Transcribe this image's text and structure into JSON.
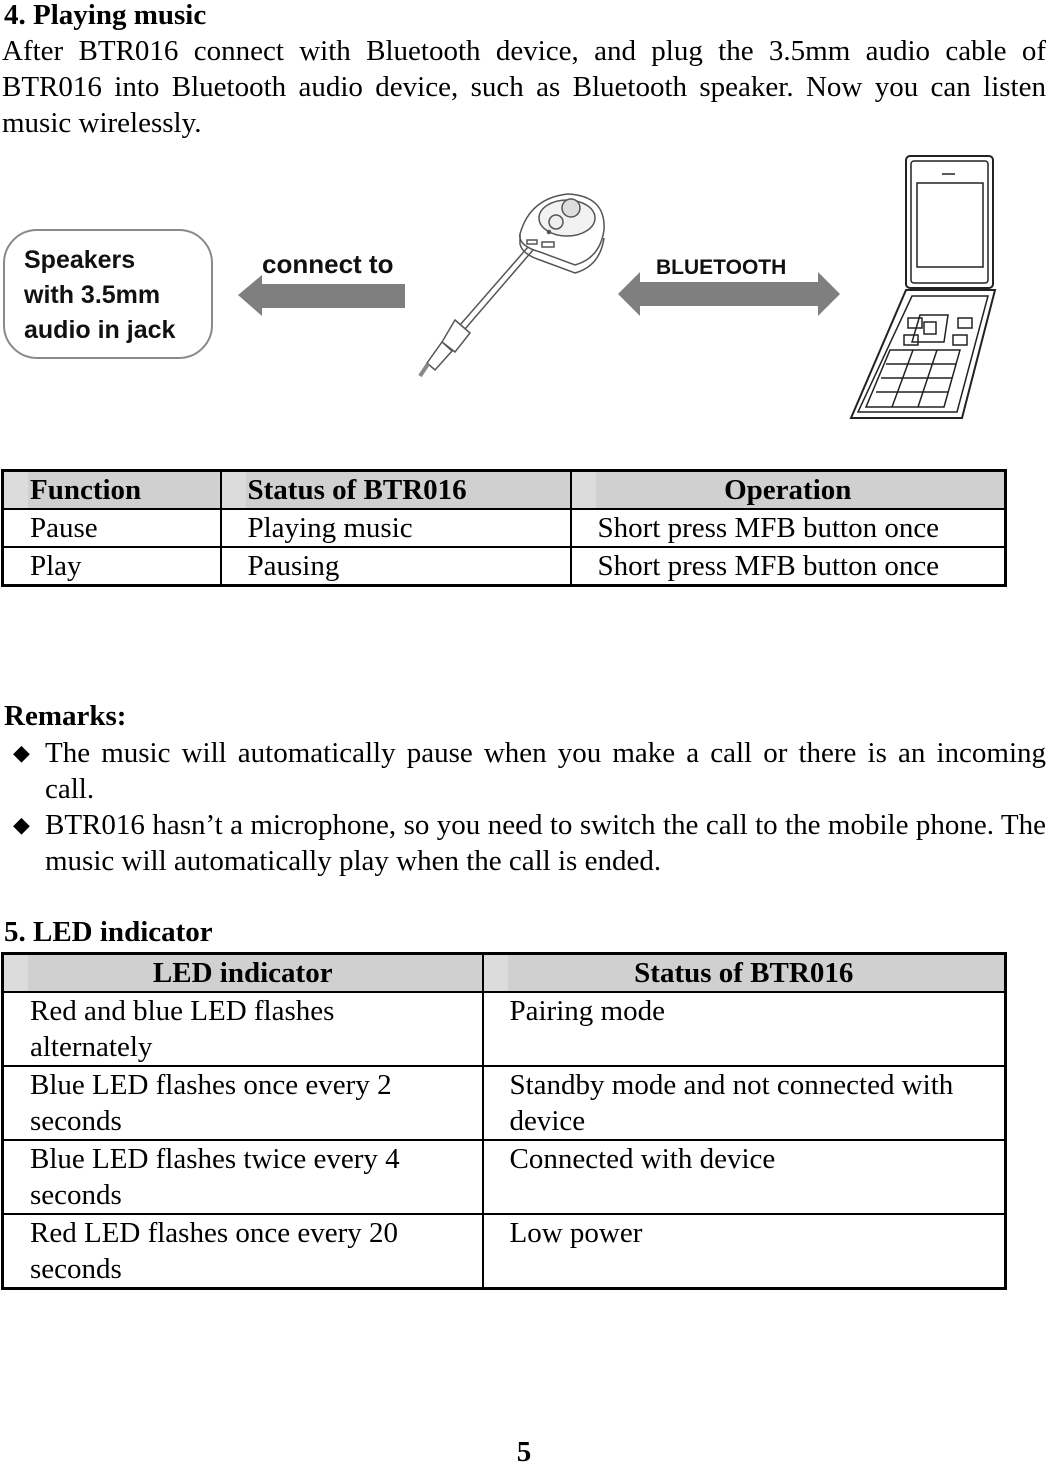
{
  "section4": {
    "heading": "4. Playing music",
    "paragraph": "After BTR016 connect with Bluetooth device, and plug the 3.5mm audio cable of BTR016 into Bluetooth audio device, such as Bluetooth speaker. Now you can listen music wirelessly."
  },
  "figure": {
    "speaker_label": "Speakers\nwith 3.5mm\naudio in jack",
    "connect_label": "connect to",
    "bluetooth_label": "BLUETOOTH",
    "arrow_color": "#7f7f7f"
  },
  "table_music": {
    "headers": [
      "Function",
      "Status of BTR016",
      "Operation"
    ],
    "rows": [
      [
        "Pause",
        "Playing music",
        "Short press MFB button once"
      ],
      [
        "Play",
        "Pausing",
        "Short press MFB button once"
      ]
    ]
  },
  "remarks": {
    "title": "Remarks:",
    "bullet_symbol": "◆",
    "items": [
      "The music will automatically pause when you make a call or there is an incoming call.",
      "BTR016 hasn’t a microphone, so you need to switch the call to the mobile phone. The music will automatically play when the call is ended."
    ]
  },
  "section5": {
    "heading": "5. LED indicator"
  },
  "table_led": {
    "headers": [
      "LED indicator",
      "Status of BTR016"
    ],
    "rows": [
      [
        "Red and blue LED flashes alternately",
        "Pairing mode"
      ],
      [
        "Blue LED flashes once every 2 seconds",
        "Standby mode and not connected with device"
      ],
      [
        "Blue LED flashes twice every 4 seconds",
        "Connected with device"
      ],
      [
        "Red LED flashes once every 20 seconds",
        "Low power"
      ]
    ]
  },
  "header_fill_color": "#d0d0d0",
  "page_number": "5"
}
